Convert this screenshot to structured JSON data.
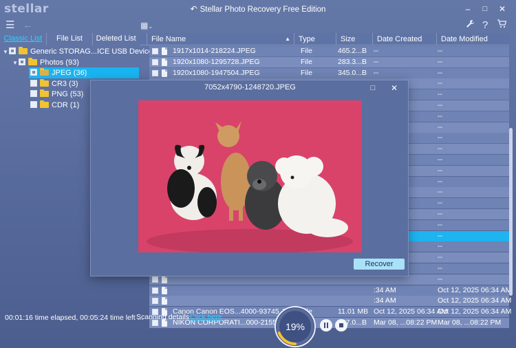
{
  "app": {
    "logo": "stellar",
    "title": "Stellar Photo Recovery Free Edition",
    "window_buttons": [
      "–",
      "□",
      "✕"
    ]
  },
  "toolbar": {
    "menu_icon": "hamburger-menu-icon",
    "back_icon": "back-arrow-icon",
    "view_icon": "grid-view-icon",
    "tools_icon": "wrench-icon",
    "help_icon": "help-icon",
    "cart_icon": "cart-icon"
  },
  "left_tabs": [
    "Classic List",
    "File List",
    "Deleted List"
  ],
  "tree": {
    "device": "Generic STORAG...ICE USB Device",
    "photos": "Photos (93)",
    "items": [
      "JPEG (36)",
      "CR3 (3)",
      "PNG (53)",
      "CDR (1)"
    ]
  },
  "table": {
    "columns": [
      "File Name",
      "Type",
      "Size",
      "Date Created",
      "Date Modified"
    ],
    "rows": [
      {
        "name": "1917x1014-218224.JPEG",
        "type": "File",
        "size": "465.2...B",
        "created": "--",
        "modified": "--"
      },
      {
        "name": "1920x1080-1295728.JPEG",
        "type": "File",
        "size": "283.3...B",
        "created": "--",
        "modified": "--"
      },
      {
        "name": "1920x1080-1947504.JPEG",
        "type": "File",
        "size": "345.0...B",
        "created": "--",
        "modified": "--"
      },
      {
        "name": "",
        "type": "",
        "size": "",
        "created": "",
        "modified": "--"
      },
      {
        "name": "",
        "type": "",
        "size": "",
        "created": "",
        "modified": "--"
      },
      {
        "name": "",
        "type": "",
        "size": "",
        "created": "",
        "modified": "--"
      },
      {
        "name": "",
        "type": "",
        "size": "",
        "created": "",
        "modified": "--"
      },
      {
        "name": "",
        "type": "",
        "size": "",
        "created": "",
        "modified": "--"
      },
      {
        "name": "",
        "type": "",
        "size": "",
        "created": "",
        "modified": "--"
      },
      {
        "name": "",
        "type": "",
        "size": "",
        "created": "",
        "modified": "--"
      },
      {
        "name": "",
        "type": "",
        "size": "",
        "created": "",
        "modified": "--"
      },
      {
        "name": "",
        "type": "",
        "size": "",
        "created": "",
        "modified": "--"
      },
      {
        "name": "",
        "type": "",
        "size": "",
        "created": "",
        "modified": "--"
      },
      {
        "name": "",
        "type": "",
        "size": "",
        "created": "",
        "modified": "--"
      },
      {
        "name": "",
        "type": "",
        "size": "",
        "created": "",
        "modified": "--"
      },
      {
        "name": "",
        "type": "",
        "size": "",
        "created": "",
        "modified": "--"
      },
      {
        "name": "",
        "type": "",
        "size": "",
        "created": "",
        "modified": "--"
      },
      {
        "name": "",
        "type": "",
        "size": "",
        "created": "",
        "modified": "--"
      },
      {
        "name": "",
        "type": "",
        "size": "",
        "created": "",
        "modified": "--"
      },
      {
        "name": "",
        "type": "",
        "size": "",
        "created": "",
        "modified": "--"
      },
      {
        "name": "",
        "type": "",
        "size": "",
        "created": "",
        "modified": "--"
      },
      {
        "name": "",
        "type": "",
        "size": "",
        "created": "",
        "modified": "--"
      },
      {
        "name": "",
        "type": "",
        "size": "",
        "created": ":34 AM",
        "modified": "Oct 12, 2025 06:34 AM"
      },
      {
        "name": "",
        "type": "",
        "size": "",
        "created": ":34 AM",
        "modified": "Oct 12, 2025 06:34 AM"
      },
      {
        "name": "Canon Canon EOS...4000-93745.JPEG",
        "type": "File",
        "size": "11.01 MB",
        "created": "Oct 12, 2025 06:34 AM",
        "modified": "Oct 12, 2025 06:34 AM"
      },
      {
        "name": "NIKON CORPORATI...000-215504.JPEG",
        "type": "File",
        "size": "847.0...B",
        "created": "Mar 08, ...08:22 PM",
        "modified": "Mar 08, ...08:22 PM"
      }
    ]
  },
  "preview": {
    "title": "7052x4790-1248720.JPEG",
    "recover_label": "Recover",
    "image_icon": "dogs-photo-preview",
    "colors": {
      "background": "#d9436a"
    }
  },
  "status": {
    "elapsed": "00:01:16 time elapsed, 00:05:24 time left ...",
    "scanning_label": "Scanning details",
    "click_here": "Click here",
    "progress_percent": 19,
    "progress_text": "19%"
  },
  "colors": {
    "accent": "#19b4f0",
    "link": "#2fd0ff",
    "progress": "#f2c230"
  }
}
